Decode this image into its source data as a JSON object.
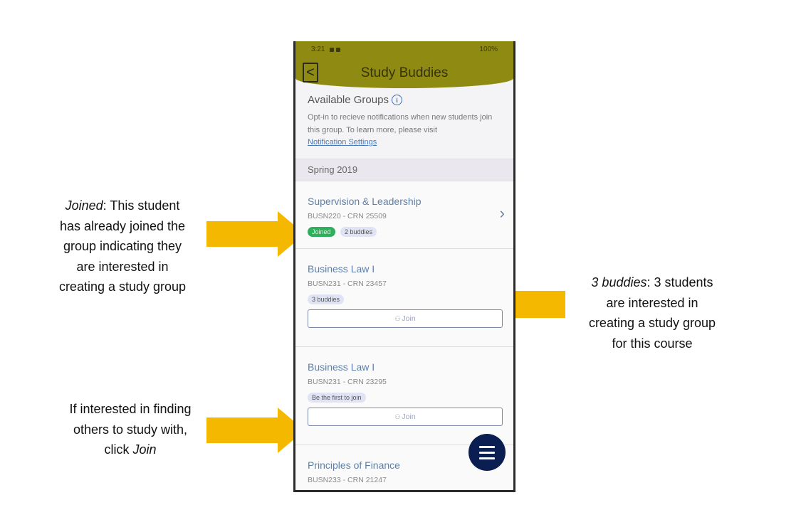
{
  "status_bar": {
    "time": "3:21",
    "right": "100%"
  },
  "header": {
    "title": "Study Buddies",
    "back_glyph": "<"
  },
  "intro": {
    "title": "Available Groups",
    "info_glyph": "i",
    "description": "Opt-in to recieve notifications when new students join this group. To learn more, please visit",
    "link": "Notification Settings"
  },
  "semester": "Spring 2019",
  "groups": [
    {
      "name": "Supervision & Leadership",
      "code": "BUSN220 - CRN 25509",
      "badge_joined": "Joined",
      "badge_count": "2 buddies"
    },
    {
      "name": "Business Law I",
      "code": "BUSN231 - CRN 23457",
      "badge_count": "3 buddies",
      "join_label": "Join"
    },
    {
      "name": "Business Law I",
      "code": "BUSN231 - CRN 23295",
      "badge_count": "Be the first to join",
      "join_label": "Join"
    },
    {
      "name": "Principles of Finance",
      "code": "BUSN233 - CRN 21247"
    }
  ],
  "annotations": {
    "joined": {
      "emph": "Joined",
      "rest_1": ": This student",
      "l2": "has already joined the",
      "l3": "group indicating they",
      "l4": "are interested in",
      "l5": "creating a study group"
    },
    "buddies": {
      "emph": "3 buddies",
      "rest_1": ": 3 students",
      "l2": "are interested in",
      "l3": "creating a study group",
      "l4": "for this course"
    },
    "join": {
      "l1": "If interested in finding",
      "l2": "others to study with,",
      "l3_pre": "click ",
      "l3_emph": "Join"
    }
  },
  "colors": {
    "header": "#8f8a12",
    "arrow": "#f5b800",
    "fab": "#0b1e52",
    "joined_badge": "#2fae5e"
  }
}
